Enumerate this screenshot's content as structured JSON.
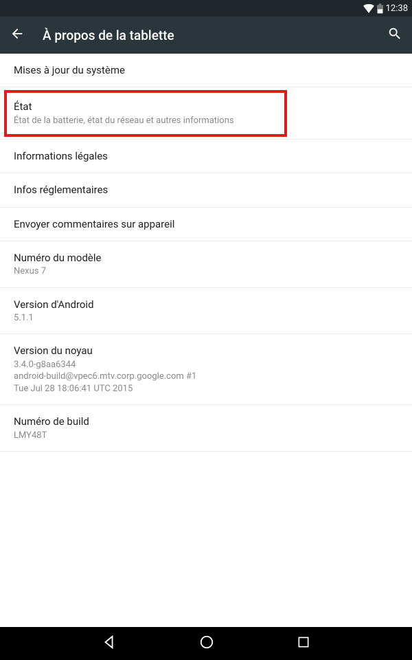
{
  "status": {
    "time": "12:38"
  },
  "appbar": {
    "title": "À propos de la tablette"
  },
  "rows": {
    "system_update": {
      "title": "Mises à jour du système"
    },
    "status": {
      "title": "État",
      "subtitle": "État de la batterie, état du réseau et autres informations"
    },
    "legal": {
      "title": "Informations légales"
    },
    "regulatory": {
      "title": "Infos réglementaires"
    },
    "feedback": {
      "title": "Envoyer commentaires sur appareil"
    },
    "model": {
      "title": "Numéro du modèle",
      "value": "Nexus 7"
    },
    "android_version": {
      "title": "Version d'Android",
      "value": "5.1.1"
    },
    "kernel": {
      "title": "Version du noyau",
      "value": "3.4.0-g8aa6344\nandroid-build@vpec6.mtv.corp.google.com #1\nTue Jul 28 18:06:41 UTC 2015"
    },
    "build": {
      "title": "Numéro de build",
      "value": "LMY48T"
    }
  }
}
